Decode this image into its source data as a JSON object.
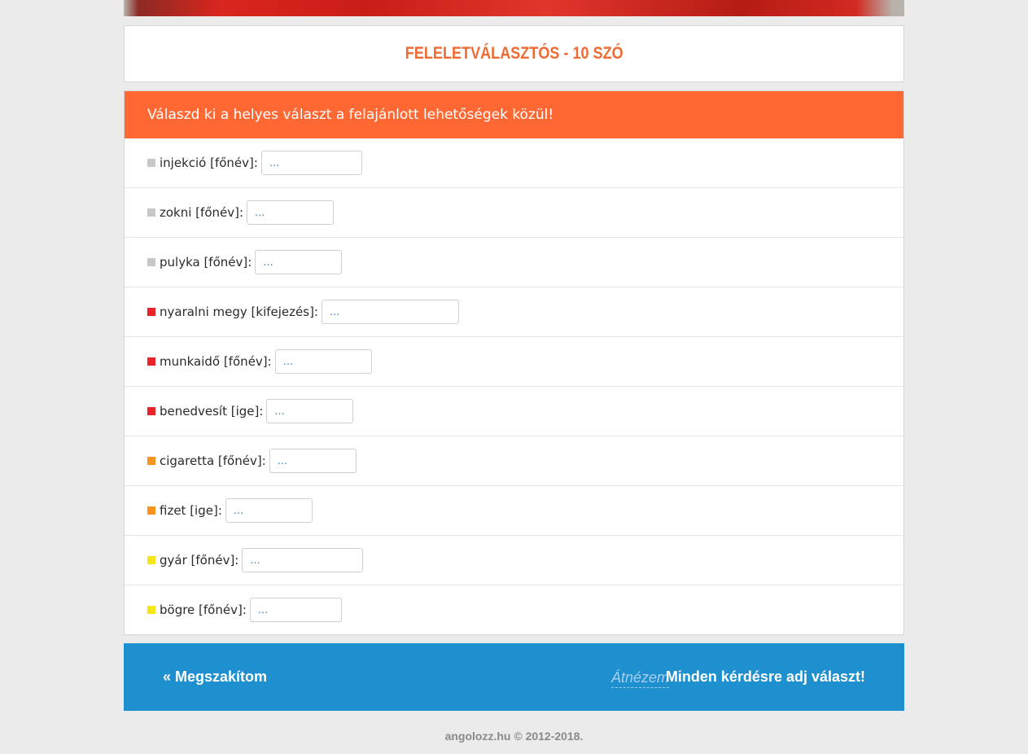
{
  "page": {
    "title": "FELELETVÁLASZTÓS - 10 SZÓ",
    "instruction": "Válaszd ki a helyes választ a felajánlott lehetőségek közül!"
  },
  "colors": {
    "accent": "#ff6733",
    "title": "#f06a34",
    "footer": "#1e8fcf",
    "level_gray": "#c8c8c8",
    "level_red": "#e8232a",
    "level_orange": "#f7941d",
    "level_yellow": "#f5e615"
  },
  "questions": [
    {
      "label": "injekció [főnév]:",
      "answer": "...",
      "level": "gray"
    },
    {
      "label": "zokni [főnév]:",
      "answer": "...",
      "level": "gray"
    },
    {
      "label": "pulyka [főnév]:",
      "answer": "...",
      "level": "gray"
    },
    {
      "label": "nyaralni megy [kifejezés]:",
      "answer": "...",
      "level": "red"
    },
    {
      "label": "munkaidő [főnév]:",
      "answer": "...",
      "level": "red"
    },
    {
      "label": "benedvesít [ige]:",
      "answer": "...",
      "level": "red"
    },
    {
      "label": "cigaretta [főnév]:",
      "answer": "...",
      "level": "orange"
    },
    {
      "label": "fizet [ige]:",
      "answer": "...",
      "level": "orange"
    },
    {
      "label": "gyár [főnév]:",
      "answer": "...",
      "level": "yellow"
    },
    {
      "label": "bögre [főnév]:",
      "answer": "...",
      "level": "yellow"
    }
  ],
  "footer": {
    "back_label": "« Megszakítom",
    "review_label": "Átnézem",
    "notice": "Minden kérdésre adj választ!"
  },
  "copyright": "angolozz.hu © 2012-2018."
}
